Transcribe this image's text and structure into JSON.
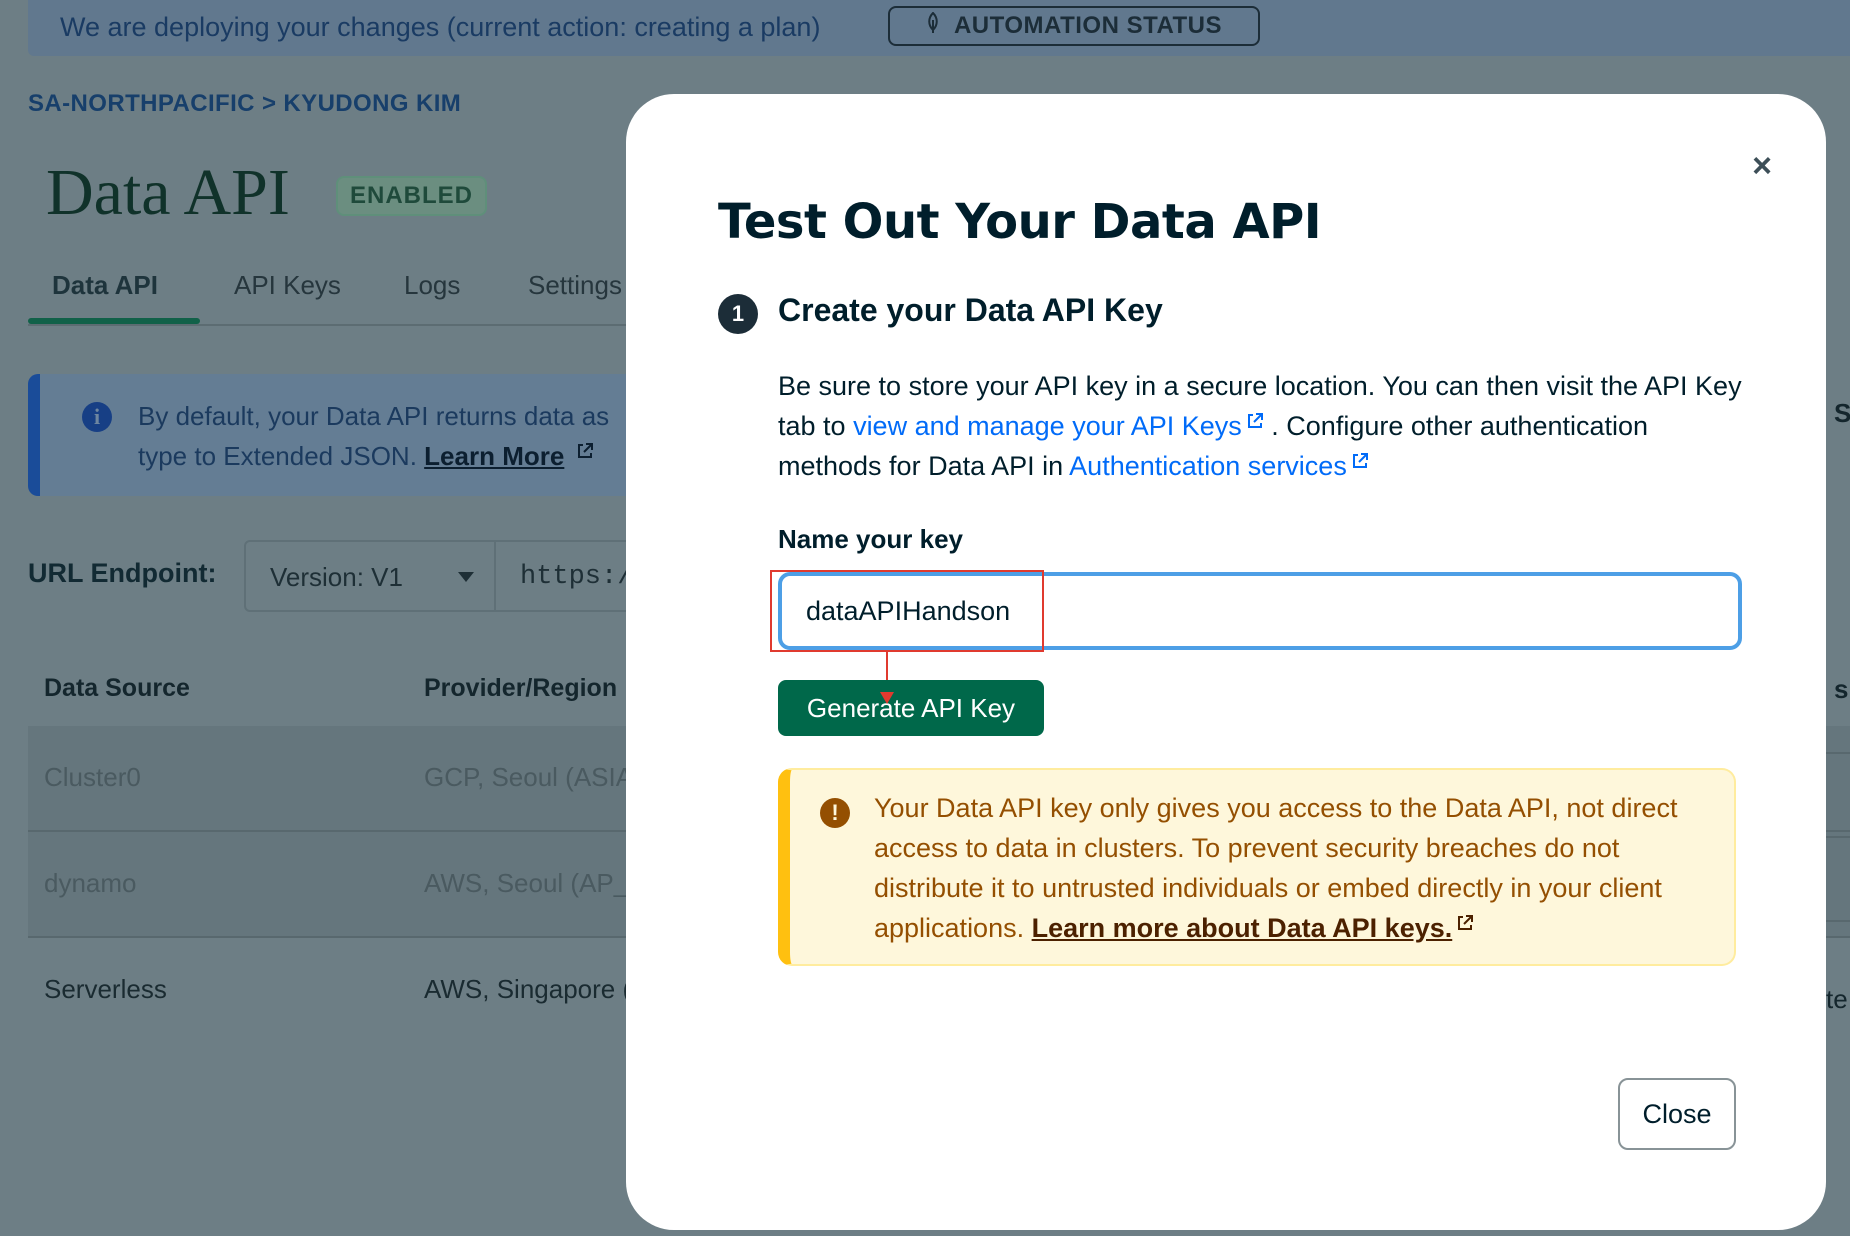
{
  "banner": {
    "message": "We are deploying your changes (current action: creating a plan)",
    "button_label": "AUTOMATION STATUS",
    "button_icon": "leaf-icon"
  },
  "breadcrumb": {
    "text": "SA-NORTHPACIFIC > KYUDONG KIM"
  },
  "page": {
    "title": "Data API",
    "badge": "ENABLED"
  },
  "tabs": [
    {
      "label": "Data API",
      "active": true
    },
    {
      "label": "API Keys",
      "active": false
    },
    {
      "label": "Logs",
      "active": false
    },
    {
      "label": "Settings",
      "active": false
    }
  ],
  "info": {
    "line1": "By default, your Data API returns data as",
    "line2": "type to Extended JSON.",
    "link": "Learn More"
  },
  "endpoint": {
    "label": "URL Endpoint:",
    "version": "Version: V1",
    "url_partial": "https:/"
  },
  "table": {
    "headers": [
      "Data Source",
      "Provider/Region"
    ],
    "rows": [
      {
        "source": "Cluster0",
        "provider": "GCP, Seoul (ASIA"
      },
      {
        "source": "dynamo",
        "provider": "AWS, Seoul (AP_N"
      },
      {
        "source": "Serverless",
        "provider": "AWS, Singapore ("
      }
    ],
    "edge_fragments": [
      "S",
      "s",
      "te"
    ]
  },
  "modal": {
    "title": "Test Out Your Data API",
    "step_number": "1",
    "step_title": "Create your Data API Key",
    "desc_part1": "Be sure to store your API key in a secure location. You can then visit the API Key tab to ",
    "desc_link1": "view and manage your API Keys",
    "desc_part2": " . Configure other authentication methods for Data API in ",
    "desc_link2": "Authentication services",
    "key_label": "Name your key",
    "key_value": "dataAPIHandson",
    "generate_label": "Generate API Key",
    "warning_text": "Your Data API key only gives you access to the Data API, not direct access to data in clusters. To prevent security breaches do not distribute it to untrusted individuals or embed directly in your client applications. ",
    "warning_link": "Learn more about Data API keys.",
    "close_label": "Close",
    "close_x": "×"
  },
  "colors": {
    "accent_green": "#00684a",
    "link_blue": "#016bf8",
    "input_border": "#4d9fe6",
    "highlight_red": "#e03a2f",
    "warning_bg": "#fef7db",
    "warning_bar": "#ffc010"
  }
}
